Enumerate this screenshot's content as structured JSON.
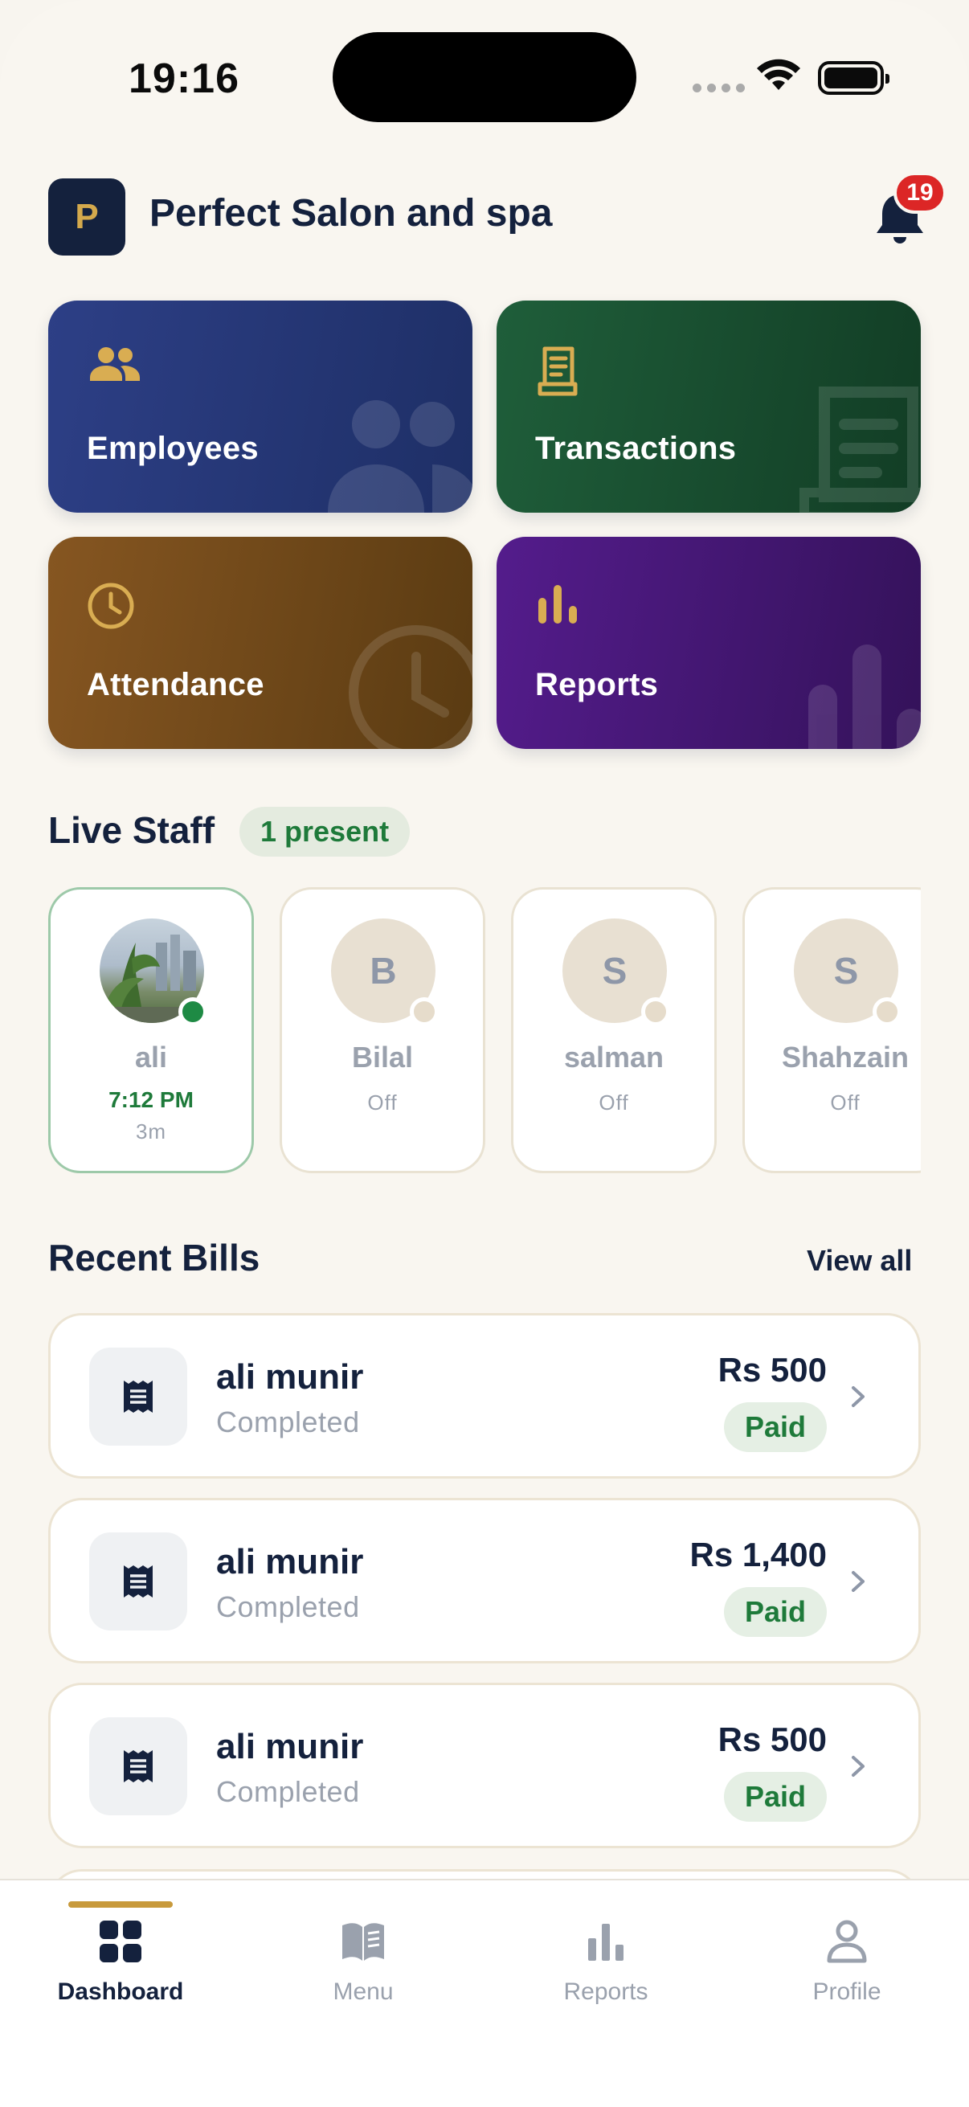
{
  "status_bar": {
    "time": "19:16"
  },
  "header": {
    "logo_letter": "P",
    "salon_name": "Perfect Salon and spa",
    "notification_count": "19"
  },
  "tiles": [
    {
      "label": "Employees",
      "icon": "people-icon",
      "color": "#2d3f86"
    },
    {
      "label": "Transactions",
      "icon": "receipt-icon",
      "color": "#1f5e3a"
    },
    {
      "label": "Attendance",
      "icon": "clock-icon",
      "color": "#865621"
    },
    {
      "label": "Reports",
      "icon": "bar-chart-icon",
      "color": "#541c8c"
    }
  ],
  "live_staff": {
    "title": "Live Staff",
    "present_badge": "1 present",
    "staff": [
      {
        "initial": "",
        "name": "ali",
        "time": "7:12 PM",
        "sub": "3m",
        "status": "present"
      },
      {
        "initial": "B",
        "name": "Bilal",
        "sub": "Off",
        "status": "off"
      },
      {
        "initial": "S",
        "name": "salman",
        "sub": "Off",
        "status": "off"
      },
      {
        "initial": "S",
        "name": "Shahzain",
        "sub": "Off",
        "status": "off"
      }
    ]
  },
  "recent_bills": {
    "title": "Recent Bills",
    "view_all": "View all",
    "bills": [
      {
        "name": "ali munir",
        "status": "Completed",
        "amount": "Rs 500",
        "badge": "Paid"
      },
      {
        "name": "ali munir",
        "status": "Completed",
        "amount": "Rs 1,400",
        "badge": "Paid"
      },
      {
        "name": "ali munir",
        "status": "Completed",
        "amount": "Rs 500",
        "badge": "Paid"
      }
    ]
  },
  "tabbar": {
    "tabs": [
      {
        "label": "Dashboard",
        "icon": "dashboard-grid-icon",
        "active": true
      },
      {
        "label": "Menu",
        "icon": "book-icon",
        "active": false
      },
      {
        "label": "Reports",
        "icon": "bar-chart-icon",
        "active": false
      },
      {
        "label": "Profile",
        "icon": "person-icon",
        "active": false
      }
    ]
  },
  "colors": {
    "accent_gold": "#c89a3c",
    "navy": "#14213d",
    "success": "#1e7a3a",
    "badge_red": "#dc2626"
  }
}
